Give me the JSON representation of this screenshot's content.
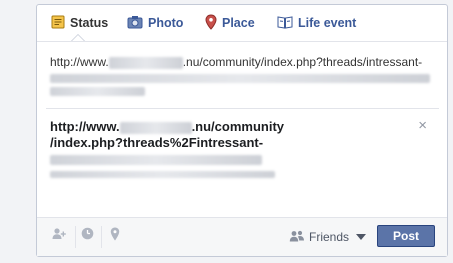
{
  "tabs": [
    {
      "label": "Status",
      "icon": "status-icon"
    },
    {
      "label": "Photo",
      "icon": "camera-icon"
    },
    {
      "label": "Place",
      "icon": "map-pin-icon"
    },
    {
      "label": "Life event",
      "icon": "book-icon"
    }
  ],
  "composer": {
    "url_prefix": "http://www.",
    "url_suffix": ".nu/community/index.php?threads/intressant-"
  },
  "preview": {
    "title_prefix": "http://www.",
    "title_suffix": ".nu/community",
    "title_line2": "/index.php?threads%2Fintressant-",
    "close": "×"
  },
  "footer": {
    "audience_label": "Friends",
    "post_label": "Post",
    "tag_people_icon": "add-person-icon",
    "schedule_icon": "clock-icon",
    "location_icon": "location-pin-icon"
  },
  "colors": {
    "link_blue": "#3b5998",
    "post_button": "#5b74a8",
    "border": "#c4cad7"
  }
}
